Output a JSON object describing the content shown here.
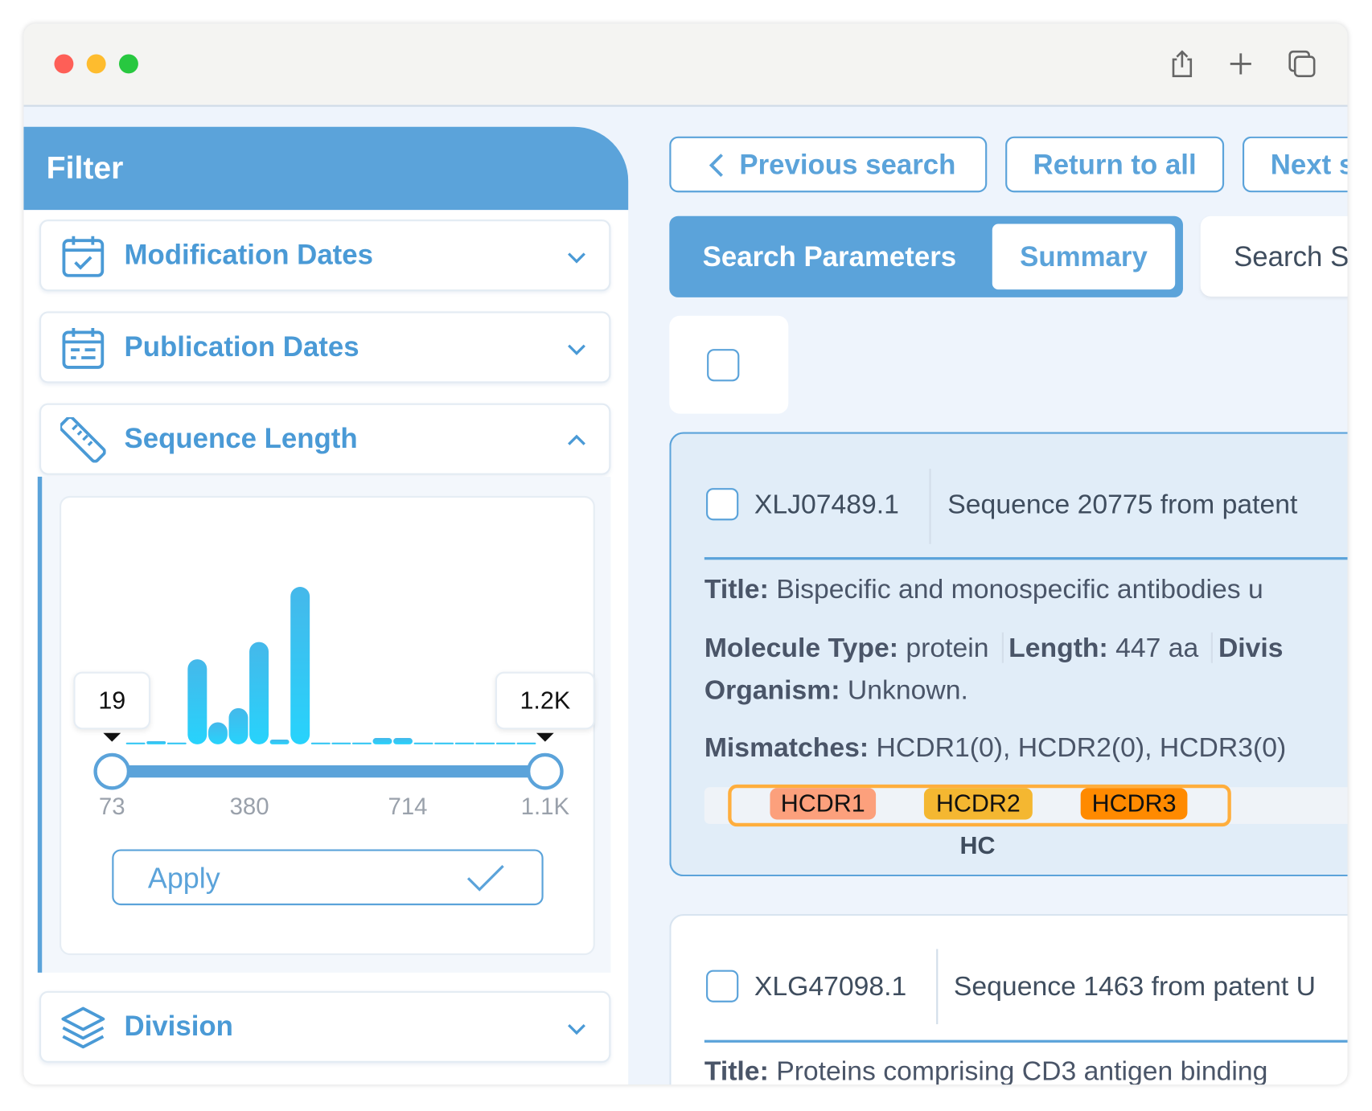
{
  "titlebar": {
    "icons": [
      "share-icon",
      "plus-icon",
      "tabs-icon"
    ],
    "traffic_lights": [
      "#fe5f57",
      "#febc2e",
      "#28c840"
    ]
  },
  "colors": {
    "accent": "#5ba3da",
    "hcdr1": "#fca07c",
    "hcdr2": "#f4b731",
    "hcdr3": "#ff8a00",
    "region_border": "#ffae3d"
  },
  "filter": {
    "title": "Filter",
    "sections": [
      {
        "label": "Modification Dates",
        "icon": "calendar-check-icon",
        "expanded": false
      },
      {
        "label": "Publication Dates",
        "icon": "calendar-icon",
        "expanded": false
      },
      {
        "label": "Sequence Length",
        "icon": "ruler-icon",
        "expanded": true
      },
      {
        "label": "Division",
        "icon": "layers-icon",
        "expanded": false
      }
    ],
    "sequence_length": {
      "min_tooltip": "19",
      "max_tooltip": "1.2K",
      "ticks": [
        "73",
        "380",
        "714",
        "1.1K"
      ],
      "apply_label": "Apply"
    }
  },
  "chart_data": {
    "type": "bar",
    "title": "",
    "xlabel": "",
    "ylabel": "",
    "values": [
      0.5,
      2,
      0.5,
      54,
      14,
      23,
      65,
      3,
      100,
      1,
      0.3,
      0.5,
      4,
      4,
      0.5,
      0.3,
      0.3,
      0.5,
      0.5,
      0.3
    ],
    "selected_range_fraction": [
      0,
      1
    ]
  },
  "nav": {
    "previous": "Previous search",
    "return": "Return to all",
    "next": "Next s"
  },
  "tabs": {
    "search_parameters": "Search Parameters",
    "summary": "Summary",
    "search": "Search S"
  },
  "results": [
    {
      "id": "XLJ07489.1",
      "description": "Sequence 20775 from patent",
      "title_label": "Title:",
      "title": "Bispecific and monospecific antibodies u",
      "molecule_label": "Molecule Type:",
      "molecule": "protein",
      "length_label": "Length:",
      "length": "447 aa",
      "division_label": "Divis",
      "organism_label": "Organism:",
      "organism": "Unknown.",
      "mismatches_label": "Mismatches:",
      "mismatches": "HCDR1(0), HCDR2(0), HCDR3(0)",
      "regions": [
        "HCDR1",
        "HCDR2",
        "HCDR3"
      ],
      "chain": "HC"
    },
    {
      "id": "XLG47098.1",
      "description": "Sequence 1463 from patent U",
      "title_label": "Title:",
      "title": "Proteins comprising CD3 antigen binding"
    }
  ]
}
